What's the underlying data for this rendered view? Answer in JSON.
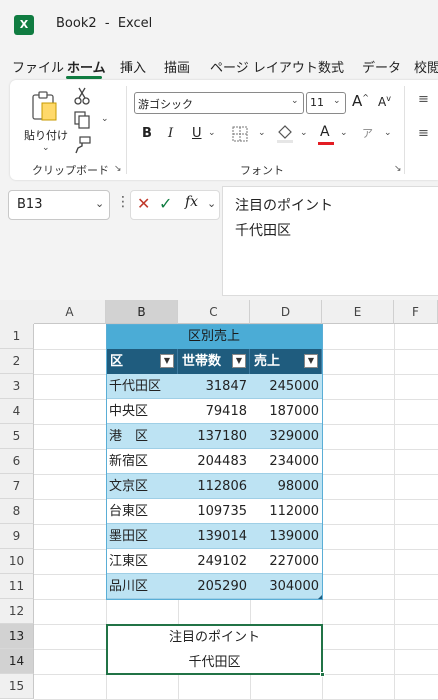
{
  "window": {
    "app_icon": "X",
    "title": "Book2  -  Excel"
  },
  "menu": [
    "ファイル",
    "ホーム",
    "挿入",
    "描画",
    "ページ レイアウト",
    "数式",
    "データ",
    "校閲"
  ],
  "ribbon": {
    "clipboard": {
      "paste_label": "貼り付け",
      "group_label": "クリップボード"
    },
    "font": {
      "font_name": "游ゴシック",
      "font_size": "11",
      "bold": "B",
      "italic": "I",
      "underline": "U",
      "grow": "A",
      "shrink": "A",
      "font_color": "A",
      "group_label": "フォント"
    }
  },
  "formula_bar": {
    "name_box": "B13",
    "fx": "fx",
    "content_line1": "注目のポイント",
    "content_line2": "千代田区"
  },
  "grid": {
    "columns": [
      "A",
      "B",
      "C",
      "D",
      "E",
      "F"
    ],
    "rows": [
      "1",
      "2",
      "3",
      "4",
      "5",
      "6",
      "7",
      "8",
      "9",
      "10",
      "11",
      "12",
      "13",
      "14",
      "15"
    ],
    "table_title": "区別売上",
    "headers": [
      "区",
      "世帯数",
      "売上"
    ],
    "data": [
      [
        "千代田区",
        "31847",
        "245000"
      ],
      [
        "中央区",
        "79418",
        "187000"
      ],
      [
        "港　区",
        "137180",
        "329000"
      ],
      [
        "新宿区",
        "204483",
        "234000"
      ],
      [
        "文京区",
        "112806",
        "98000"
      ],
      [
        "台東区",
        "109735",
        "112000"
      ],
      [
        "墨田区",
        "139014",
        "139000"
      ],
      [
        "江東区",
        "249102",
        "227000"
      ],
      [
        "品川区",
        "205290",
        "304000"
      ]
    ],
    "note_line1": "注目のポイント",
    "note_line2": "千代田区"
  },
  "colors": {
    "accent": "#107c41",
    "title_fill": "#4bacd6",
    "header_fill": "#1f5c7e",
    "band_fill": "#bde3f3",
    "selection_border": "#217346"
  }
}
